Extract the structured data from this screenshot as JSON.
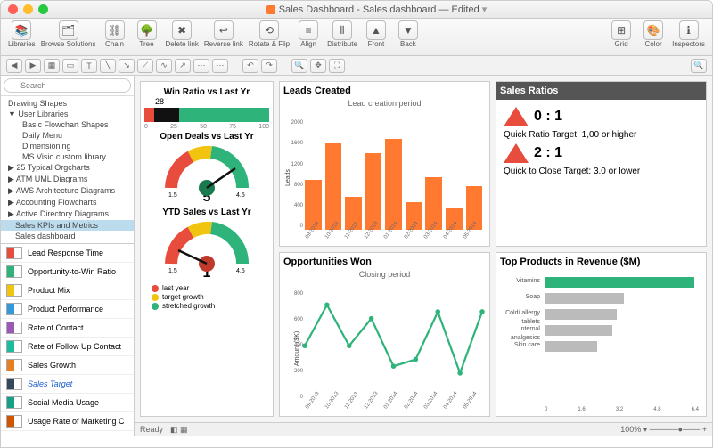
{
  "window": {
    "title": "Sales Dashboard - Sales dashboard — Edited"
  },
  "toolbar": {
    "items": [
      "Libraries",
      "Browse Solutions",
      "Chain",
      "Tree",
      "Delete link",
      "Reverse link",
      "Rotate & Flip",
      "Align",
      "Distribute",
      "Front",
      "Back",
      "",
      "Grid",
      "Color",
      "Inspectors"
    ]
  },
  "sidebar": {
    "search_placeholder": "Search",
    "tree": [
      {
        "label": "Drawing Shapes",
        "lvl": 0
      },
      {
        "label": "User Libraries",
        "lvl": 0,
        "tri": "▼"
      },
      {
        "label": "Basic Flowchart Shapes",
        "lvl": 2
      },
      {
        "label": "Daily Menu",
        "lvl": 2
      },
      {
        "label": "Dimensioning",
        "lvl": 2
      },
      {
        "label": "MS Visio custom library",
        "lvl": 2
      },
      {
        "label": "25 Typical Orgcharts",
        "lvl": 0,
        "tri": "▶"
      },
      {
        "label": "ATM UML Diagrams",
        "lvl": 0,
        "tri": "▶"
      },
      {
        "label": "AWS Architecture Diagrams",
        "lvl": 0,
        "tri": "▶"
      },
      {
        "label": "Accounting Flowcharts",
        "lvl": 0,
        "tri": "▶"
      },
      {
        "label": "Active Directory Diagrams",
        "lvl": 0,
        "tri": "▶"
      },
      {
        "label": "Sales KPIs and Metrics",
        "lvl": 1,
        "sel": true
      },
      {
        "label": "Sales dashboard",
        "lvl": 1
      }
    ],
    "lib": [
      "Lead Response Time",
      "Opportunity-to-Win Ratio",
      "Product Mix",
      "Product Performance",
      "Rate of Contact",
      "Rate of Follow Up Contact",
      "Sales Growth",
      "Sales Target",
      "Social Media Usage",
      "Usage Rate of Marketing C"
    ],
    "lib_sel": 7
  },
  "status": {
    "ready": "Ready",
    "zoom": "100%"
  },
  "chart_data": [
    {
      "type": "bar",
      "title": "Win Ratio vs Last Yr",
      "orientation": "h-stacked",
      "value_label": "28",
      "segments": [
        {
          "color": "#e74c3c",
          "v": 8
        },
        {
          "color": "#111",
          "v": 20
        },
        {
          "color": "#2eb37a",
          "v": 72
        }
      ],
      "ticks": [
        0,
        25,
        50,
        75,
        100
      ]
    },
    {
      "type": "gauge",
      "title": "Open Deals vs Last Yr",
      "value": 5,
      "min": 1.5,
      "max": 4.5,
      "zones": [
        {
          "color": "#e74c3c"
        },
        {
          "color": "#f1c40f"
        },
        {
          "color": "#2eb37a"
        }
      ]
    },
    {
      "type": "gauge",
      "title": "YTD Sales vs Last Yr",
      "value": 1,
      "min": 1.5,
      "max": 4.5,
      "zones": [
        {
          "color": "#e74c3c"
        },
        {
          "color": "#f1c40f"
        },
        {
          "color": "#2eb37a"
        }
      ],
      "legend": [
        {
          "label": "last year",
          "color": "#e74c3c"
        },
        {
          "label": "target growth",
          "color": "#f1c40f"
        },
        {
          "label": "stretched growth",
          "color": "#2eb37a"
        }
      ]
    },
    {
      "type": "bar",
      "title": "Leads Created",
      "subtitle": "Lead creation period",
      "ylabel": "Leads",
      "categories": [
        "09-2013",
        "10-2013",
        "11-2013",
        "12-2013",
        "01-2014",
        "02-2014",
        "03-2014",
        "04-2014",
        "05-2014"
      ],
      "values": [
        900,
        1600,
        600,
        1400,
        1650,
        500,
        950,
        400,
        800
      ],
      "ylim": [
        0,
        2000
      ],
      "yticks": [
        0,
        400,
        800,
        1200,
        1600,
        2000
      ],
      "color": "#ff7a30"
    },
    {
      "type": "line",
      "title": "Opportunities Won",
      "subtitle": "Closing period",
      "ylabel": "Amount ($K)",
      "categories": [
        "09-2013",
        "10-2013",
        "11-2013",
        "12-2013",
        "01-2014",
        "02-2014",
        "03-2014",
        "04-2014",
        "05-2014"
      ],
      "values": [
        400,
        700,
        400,
        600,
        250,
        300,
        650,
        200,
        650
      ],
      "ylim": [
        0,
        800
      ],
      "yticks": [
        0,
        200,
        400,
        600,
        800
      ],
      "color": "#2eb37a"
    },
    {
      "type": "kpi",
      "title": "Sales Ratios",
      "items": [
        {
          "value": "0 : 1",
          "desc": "Quick Ratio Target: 1,00 or higher"
        },
        {
          "value": "2 : 1",
          "desc": "Quick to Close Target: 3.0 or lower"
        }
      ]
    },
    {
      "type": "bar",
      "title": "Top Products in Revenue ($M)",
      "orientation": "h",
      "categories": [
        "Vitamins",
        "Soap",
        "Cold/ allergy tablets",
        "Internal analgesics",
        "Skin care"
      ],
      "values": [
        6.2,
        3.3,
        3.0,
        2.8,
        2.2
      ],
      "xlim": [
        0,
        6.4
      ],
      "xticks": [
        0,
        1.6,
        3.2,
        4.8,
        6.4
      ],
      "highlight": 0,
      "color": "#bbb",
      "highlight_color": "#2eb37a"
    }
  ]
}
